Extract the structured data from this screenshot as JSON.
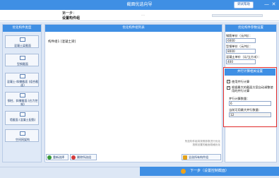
{
  "window": {
    "title": "截面优选向导",
    "help_label": "调试帮助",
    "minimize_glyph": "—",
    "close_glyph": "✕"
  },
  "step": {
    "label": "第一步：",
    "name": "设置构件组",
    "dots": "…"
  },
  "left_panel": {
    "title": "优化构件类型",
    "items": [
      {
        "label": "混凝土梁截面",
        "icon": "rc-beam-section-icon"
      },
      {
        "label": "型钢截面",
        "icon": "steel-section-icon"
      },
      {
        "label": "混凝土-斜撑截面 (组合截面)",
        "icon": "rc-brace-section-icon"
      },
      {
        "label": "钢柱、斜撑截面 (应力控制)",
        "icon": "steel-column-icon"
      },
      {
        "label": "墙截面 (混凝土配筋)",
        "icon": "wall-section-icon"
      },
      {
        "label": "空间网架构",
        "icon": "space-truss-icon"
      }
    ]
  },
  "middle_panel": {
    "title": "优化构件组列表",
    "items": [
      {
        "label": "构件组1 [混凝土梁]"
      }
    ],
    "note_lines": [
      "所选构件组将按照参数进行优化",
      "按照设置的截面规格优化"
    ],
    "buttons": {
      "new_group": "重新选择",
      "delete_group": "删除所选组",
      "export": "全选所有构件组"
    }
  },
  "right_panel": {
    "title": "优化构件参数设置",
    "fields": [
      {
        "label": "钢筋单价（元/吨）：",
        "value": "6000"
      },
      {
        "label": "型钢单价（元/吨）：",
        "value": "8000"
      },
      {
        "label": "混凝土单价（元/立方米）：",
        "value": "400"
      }
    ],
    "parallel": {
      "title": "并行计算相关设置",
      "use_parallel_label": "使用并行计算",
      "use_parallel_checked": true,
      "adjust_label": "根据最大的截面方案自动调整使用的并行计算",
      "adjust_checked": true,
      "thread_count_label": "并行计算数量：",
      "thread_count_value": "6",
      "max_parallel_label": "当前可用最大并行数量：",
      "max_parallel_value": "12"
    }
  },
  "bottom": {
    "next_label": "下一步（设置控制截面）"
  },
  "colors": {
    "accent": "#3f8fe4",
    "highlight_border": "#e12a2a",
    "panel_bg": "#dde7f5"
  }
}
